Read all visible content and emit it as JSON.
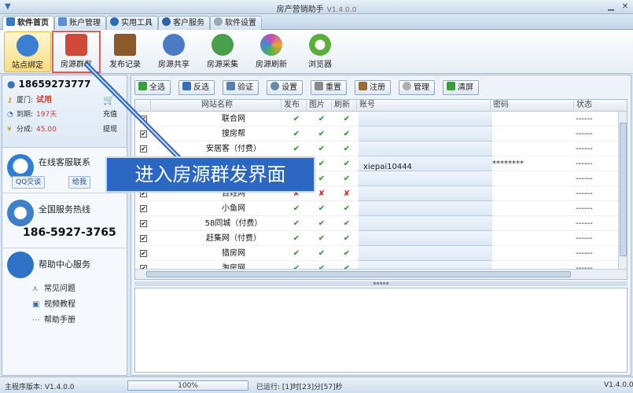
{
  "window": {
    "title": "房产营销助手",
    "version": "V1.4.0.0"
  },
  "tabs": [
    {
      "label": "软件首页",
      "active": true
    },
    {
      "label": "账户管理"
    },
    {
      "label": "实用工具"
    },
    {
      "label": "客户服务"
    },
    {
      "label": "软件设置"
    }
  ],
  "toolbar": [
    {
      "label": "站点绑定",
      "icon": "person-bind-icon",
      "color": "#3a7fd0",
      "active": true
    },
    {
      "label": "房源群发",
      "icon": "house-icon",
      "color": "#d04a3a",
      "highlight": true
    },
    {
      "label": "发布记录",
      "icon": "notebook-icon",
      "color": "#8a5a2b"
    },
    {
      "label": "房源共享",
      "icon": "paperclip-icon",
      "color": "#4a7bc4"
    },
    {
      "label": "房源采集",
      "icon": "magnifier-icon",
      "color": "#4aa04a"
    },
    {
      "label": "房源刷新",
      "icon": "refresh-ring-icon",
      "color": "#c94ab3"
    },
    {
      "label": "浏览器",
      "icon": "globe-icon",
      "color": "#5aae3a"
    }
  ],
  "account": {
    "phone": "18659273777",
    "city_label": "厦门:",
    "city_value": "试用",
    "expire_label": "到期:",
    "expire_value": "197天",
    "points_label": "分成:",
    "points_value": "45.00",
    "recharge": "充值",
    "withdraw": "提现"
  },
  "support": {
    "online_title": "在线客服联系",
    "qq_button": "QQ交谈",
    "msg_button": "给我",
    "hotline_title": "全国服务热线",
    "hotline": "186-5927-3765",
    "help_title": "帮助中心服务",
    "help_items": [
      "常见问题",
      "视频教程",
      "帮助手册"
    ]
  },
  "actions": [
    "全选",
    "反选",
    "验证",
    "设置",
    "重置",
    "注册",
    "管理",
    "清屏"
  ],
  "grid": {
    "headers": [
      "网站名称",
      "发布",
      "图片",
      "刷新",
      "账号",
      "密码",
      "状态"
    ],
    "rows": [
      {
        "name": "联合网",
        "m": [
          "✔",
          "✔",
          "✔"
        ],
        "account": "",
        "password": "",
        "status": "------"
      },
      {
        "name": "搜房帮",
        "m": [
          "✔",
          "✔",
          "✔"
        ],
        "account": "",
        "password": "",
        "status": "------"
      },
      {
        "name": "安居客（付费）",
        "m": [
          "✔",
          "✔",
          "✔"
        ],
        "account": "",
        "password": "",
        "status": "------"
      },
      {
        "name": "",
        "m": [
          "✔",
          "✔",
          "✔"
        ],
        "account": "xiepai10444",
        "password": "********",
        "status": "------"
      },
      {
        "name": "",
        "m": [
          "✔",
          "✔",
          "✔"
        ],
        "account": "",
        "password": "",
        "status": "------"
      },
      {
        "name": "百姓网",
        "m": [
          "✘",
          "✘",
          "✘"
        ],
        "account": "",
        "password": "",
        "status": "------"
      },
      {
        "name": "小鱼网",
        "m": [
          "✔",
          "✔",
          "✔"
        ],
        "account": "",
        "password": "",
        "status": "------"
      },
      {
        "name": "58同城（付费）",
        "m": [
          "✔",
          "✔",
          "✔"
        ],
        "account": "",
        "password": "",
        "status": "------"
      },
      {
        "name": "赶集网（付费）",
        "m": [
          "✔",
          "✔",
          "✔"
        ],
        "account": "",
        "password": "",
        "status": "------"
      },
      {
        "name": "猎房网",
        "m": [
          "✔",
          "✔",
          "✔"
        ],
        "account": "",
        "password": "",
        "status": "------"
      },
      {
        "name": "淘房网",
        "m": [
          "✔",
          "✔",
          "✔"
        ],
        "account": "",
        "password": "",
        "status": "------"
      }
    ]
  },
  "callout": "进入房源群发界面",
  "status": {
    "version": "主程序版本: V1.4.0.0",
    "progress": "100%",
    "progress_value": 1.0,
    "runtime": "已运行: [1]时[23]分[57]秒",
    "version_short": "V1.4.0.0"
  }
}
